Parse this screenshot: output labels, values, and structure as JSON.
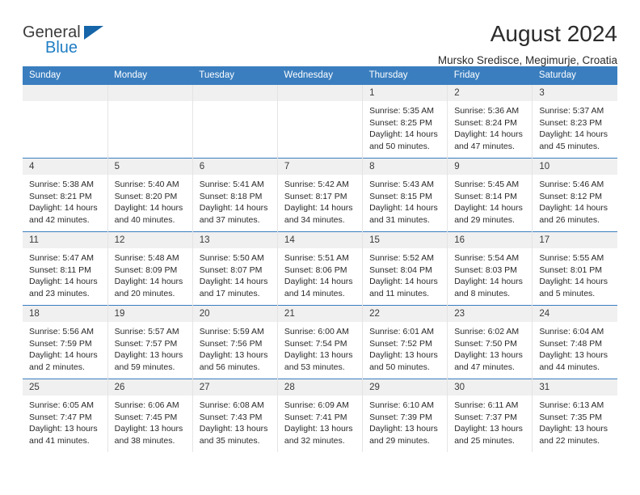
{
  "brand": {
    "line1": "General",
    "line2": "Blue",
    "triangle_color": "#1565a8",
    "line2_color": "#1f7ec4"
  },
  "header": {
    "title": "August 2024",
    "subtitle": "Mursko Sredisce, Megimurje, Croatia"
  },
  "colors": {
    "header_row": "#3a7ebf",
    "daynum_bg": "#f0f0f0",
    "cell_bg": "#ffffff",
    "grid_line": "#e4e4e4"
  },
  "weekday_headers": [
    "Sunday",
    "Monday",
    "Tuesday",
    "Wednesday",
    "Thursday",
    "Friday",
    "Saturday"
  ],
  "labels": {
    "sunrise": "Sunrise:",
    "sunset": "Sunset:",
    "daylight": "Daylight:"
  },
  "weeks": [
    [
      {
        "day": "",
        "empty": true
      },
      {
        "day": "",
        "empty": true
      },
      {
        "day": "",
        "empty": true
      },
      {
        "day": "",
        "empty": true
      },
      {
        "day": "1",
        "sunrise": "Sunrise: 5:35 AM",
        "sunset": "Sunset: 8:25 PM",
        "daylight": "Daylight: 14 hours and 50 minutes."
      },
      {
        "day": "2",
        "sunrise": "Sunrise: 5:36 AM",
        "sunset": "Sunset: 8:24 PM",
        "daylight": "Daylight: 14 hours and 47 minutes."
      },
      {
        "day": "3",
        "sunrise": "Sunrise: 5:37 AM",
        "sunset": "Sunset: 8:23 PM",
        "daylight": "Daylight: 14 hours and 45 minutes."
      }
    ],
    [
      {
        "day": "4",
        "sunrise": "Sunrise: 5:38 AM",
        "sunset": "Sunset: 8:21 PM",
        "daylight": "Daylight: 14 hours and 42 minutes."
      },
      {
        "day": "5",
        "sunrise": "Sunrise: 5:40 AM",
        "sunset": "Sunset: 8:20 PM",
        "daylight": "Daylight: 14 hours and 40 minutes."
      },
      {
        "day": "6",
        "sunrise": "Sunrise: 5:41 AM",
        "sunset": "Sunset: 8:18 PM",
        "daylight": "Daylight: 14 hours and 37 minutes."
      },
      {
        "day": "7",
        "sunrise": "Sunrise: 5:42 AM",
        "sunset": "Sunset: 8:17 PM",
        "daylight": "Daylight: 14 hours and 34 minutes."
      },
      {
        "day": "8",
        "sunrise": "Sunrise: 5:43 AM",
        "sunset": "Sunset: 8:15 PM",
        "daylight": "Daylight: 14 hours and 31 minutes."
      },
      {
        "day": "9",
        "sunrise": "Sunrise: 5:45 AM",
        "sunset": "Sunset: 8:14 PM",
        "daylight": "Daylight: 14 hours and 29 minutes."
      },
      {
        "day": "10",
        "sunrise": "Sunrise: 5:46 AM",
        "sunset": "Sunset: 8:12 PM",
        "daylight": "Daylight: 14 hours and 26 minutes."
      }
    ],
    [
      {
        "day": "11",
        "sunrise": "Sunrise: 5:47 AM",
        "sunset": "Sunset: 8:11 PM",
        "daylight": "Daylight: 14 hours and 23 minutes."
      },
      {
        "day": "12",
        "sunrise": "Sunrise: 5:48 AM",
        "sunset": "Sunset: 8:09 PM",
        "daylight": "Daylight: 14 hours and 20 minutes."
      },
      {
        "day": "13",
        "sunrise": "Sunrise: 5:50 AM",
        "sunset": "Sunset: 8:07 PM",
        "daylight": "Daylight: 14 hours and 17 minutes."
      },
      {
        "day": "14",
        "sunrise": "Sunrise: 5:51 AM",
        "sunset": "Sunset: 8:06 PM",
        "daylight": "Daylight: 14 hours and 14 minutes."
      },
      {
        "day": "15",
        "sunrise": "Sunrise: 5:52 AM",
        "sunset": "Sunset: 8:04 PM",
        "daylight": "Daylight: 14 hours and 11 minutes."
      },
      {
        "day": "16",
        "sunrise": "Sunrise: 5:54 AM",
        "sunset": "Sunset: 8:03 PM",
        "daylight": "Daylight: 14 hours and 8 minutes."
      },
      {
        "day": "17",
        "sunrise": "Sunrise: 5:55 AM",
        "sunset": "Sunset: 8:01 PM",
        "daylight": "Daylight: 14 hours and 5 minutes."
      }
    ],
    [
      {
        "day": "18",
        "sunrise": "Sunrise: 5:56 AM",
        "sunset": "Sunset: 7:59 PM",
        "daylight": "Daylight: 14 hours and 2 minutes."
      },
      {
        "day": "19",
        "sunrise": "Sunrise: 5:57 AM",
        "sunset": "Sunset: 7:57 PM",
        "daylight": "Daylight: 13 hours and 59 minutes."
      },
      {
        "day": "20",
        "sunrise": "Sunrise: 5:59 AM",
        "sunset": "Sunset: 7:56 PM",
        "daylight": "Daylight: 13 hours and 56 minutes."
      },
      {
        "day": "21",
        "sunrise": "Sunrise: 6:00 AM",
        "sunset": "Sunset: 7:54 PM",
        "daylight": "Daylight: 13 hours and 53 minutes."
      },
      {
        "day": "22",
        "sunrise": "Sunrise: 6:01 AM",
        "sunset": "Sunset: 7:52 PM",
        "daylight": "Daylight: 13 hours and 50 minutes."
      },
      {
        "day": "23",
        "sunrise": "Sunrise: 6:02 AM",
        "sunset": "Sunset: 7:50 PM",
        "daylight": "Daylight: 13 hours and 47 minutes."
      },
      {
        "day": "24",
        "sunrise": "Sunrise: 6:04 AM",
        "sunset": "Sunset: 7:48 PM",
        "daylight": "Daylight: 13 hours and 44 minutes."
      }
    ],
    [
      {
        "day": "25",
        "sunrise": "Sunrise: 6:05 AM",
        "sunset": "Sunset: 7:47 PM",
        "daylight": "Daylight: 13 hours and 41 minutes."
      },
      {
        "day": "26",
        "sunrise": "Sunrise: 6:06 AM",
        "sunset": "Sunset: 7:45 PM",
        "daylight": "Daylight: 13 hours and 38 minutes."
      },
      {
        "day": "27",
        "sunrise": "Sunrise: 6:08 AM",
        "sunset": "Sunset: 7:43 PM",
        "daylight": "Daylight: 13 hours and 35 minutes."
      },
      {
        "day": "28",
        "sunrise": "Sunrise: 6:09 AM",
        "sunset": "Sunset: 7:41 PM",
        "daylight": "Daylight: 13 hours and 32 minutes."
      },
      {
        "day": "29",
        "sunrise": "Sunrise: 6:10 AM",
        "sunset": "Sunset: 7:39 PM",
        "daylight": "Daylight: 13 hours and 29 minutes."
      },
      {
        "day": "30",
        "sunrise": "Sunrise: 6:11 AM",
        "sunset": "Sunset: 7:37 PM",
        "daylight": "Daylight: 13 hours and 25 minutes."
      },
      {
        "day": "31",
        "sunrise": "Sunrise: 6:13 AM",
        "sunset": "Sunset: 7:35 PM",
        "daylight": "Daylight: 13 hours and 22 minutes."
      }
    ]
  ]
}
